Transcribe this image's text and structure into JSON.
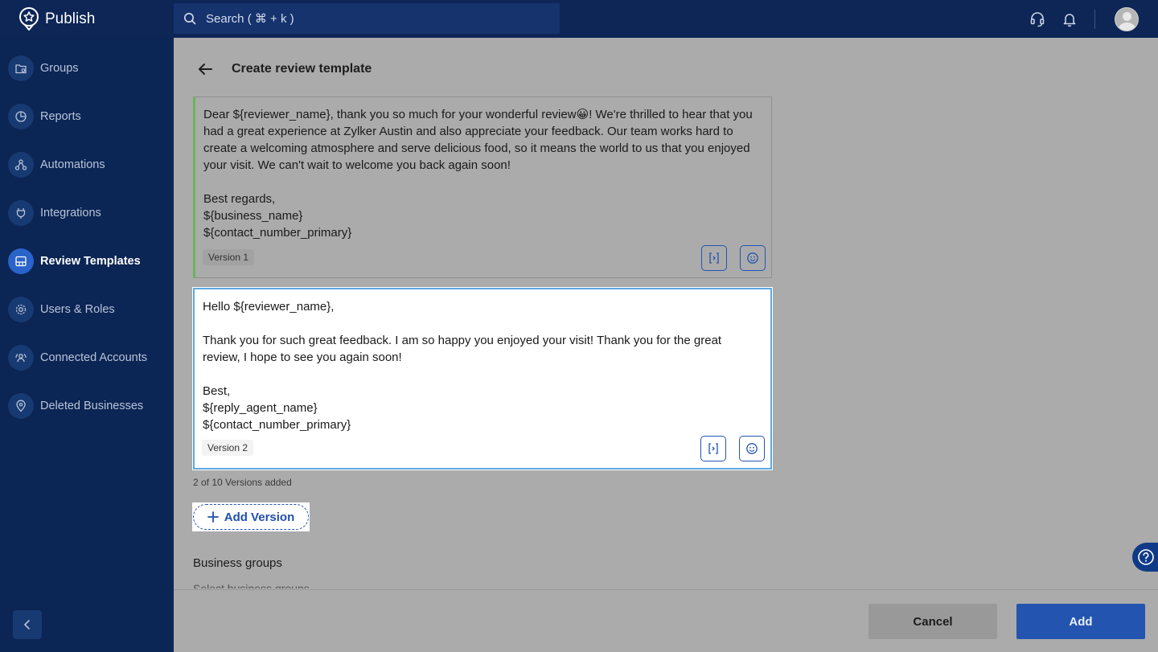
{
  "app": {
    "name": "Publish"
  },
  "search": {
    "placeholder": "Search ( ⌘ + k )"
  },
  "topbar": {
    "icons": [
      "headset-icon",
      "bell-icon",
      "avatar"
    ]
  },
  "sidebar": {
    "items": [
      {
        "label": "Groups",
        "icon": "groups-icon",
        "active": false
      },
      {
        "label": "Reports",
        "icon": "pie-chart-icon",
        "active": false
      },
      {
        "label": "Automations",
        "icon": "automation-icon",
        "active": false
      },
      {
        "label": "Integrations",
        "icon": "plug-icon",
        "active": false
      },
      {
        "label": "Review Templates",
        "icon": "template-icon",
        "active": true
      },
      {
        "label": "Users & Roles",
        "icon": "gear-icon",
        "active": false
      },
      {
        "label": "Connected Accounts",
        "icon": "connected-accounts-icon",
        "active": false
      },
      {
        "label": "Deleted Businesses",
        "icon": "location-pin-icon",
        "active": false
      }
    ]
  },
  "page": {
    "title": "Create review template"
  },
  "versions": [
    {
      "text": "Dear ${reviewer_name}, thank you so much for your wonderful review😀! We're thrilled to hear that you had a great experience at Zylker Austin and also appreciate your feedback. Our team works hard to create a welcoming atmosphere and serve delicious food, so it means the world to us that you enjoyed your visit. We can't wait to welcome you back again soon!\n\nBest regards,\n${business_name}\n${contact_number_primary}",
      "tag": "Version 1"
    },
    {
      "text": "Hello ${reviewer_name},\n\nThank you for such great feedback. I am so happy you enjoyed your visit! Thank you for the great review, I hope to see you again soon!\n\nBest,\n${reply_agent_name}\n${contact_number_primary}",
      "tag": "Version 2"
    }
  ],
  "versions_count": "2 of 10 Versions added",
  "add_version_label": "Add Version",
  "business_groups": {
    "label": "Business groups",
    "placeholder": "Select business groups"
  },
  "footer": {
    "cancel_label": "Cancel",
    "add_label": "Add"
  },
  "colors": {
    "accent": "#2354b0",
    "topbar": "#0d2656",
    "sidebar": "#0b2554",
    "active_version_border": "#5fa8e0",
    "version_1_bar": "#67b65a"
  }
}
